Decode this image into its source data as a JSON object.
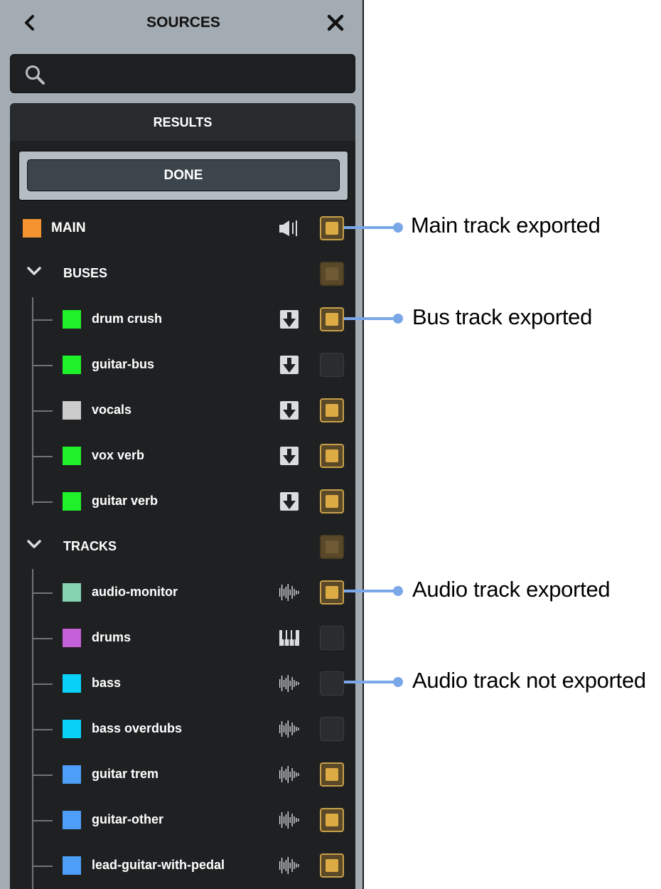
{
  "header": {
    "title": "SOURCES"
  },
  "search": {
    "placeholder": ""
  },
  "results": {
    "label": "RESULTS",
    "done_label": "DONE"
  },
  "main": {
    "label": "MAIN",
    "color": "#f59331",
    "icon": "speaker-icon",
    "exported": true
  },
  "buses": {
    "label": "BUSES",
    "items": [
      {
        "label": "drum crush",
        "color": "#1ef02a",
        "icon": "bus-down-arrow-icon",
        "exported": true
      },
      {
        "label": "guitar-bus",
        "color": "#1ef02a",
        "icon": "bus-down-arrow-icon",
        "exported": false
      },
      {
        "label": "vocals",
        "color": "#cccccc",
        "icon": "bus-down-arrow-icon",
        "exported": true
      },
      {
        "label": "vox verb",
        "color": "#1ef02a",
        "icon": "bus-down-arrow-icon",
        "exported": true
      },
      {
        "label": "guitar verb",
        "color": "#1ef02a",
        "icon": "bus-down-arrow-icon",
        "exported": true
      }
    ]
  },
  "tracks": {
    "label": "TRACKS",
    "items": [
      {
        "label": "audio-monitor",
        "color": "#86d3b2",
        "icon": "waveform-icon",
        "exported": true
      },
      {
        "label": "drums",
        "color": "#c460d8",
        "icon": "piano-keys-icon",
        "exported": false
      },
      {
        "label": "bass",
        "color": "#07d1f7",
        "icon": "waveform-icon",
        "exported": false
      },
      {
        "label": "bass overdubs",
        "color": "#07d1f7",
        "icon": "waveform-icon",
        "exported": false
      },
      {
        "label": "guitar trem",
        "color": "#4d9ef6",
        "icon": "waveform-icon",
        "exported": true
      },
      {
        "label": "guitar-other",
        "color": "#4d9ef6",
        "icon": "waveform-icon",
        "exported": true
      },
      {
        "label": "lead-guitar-with-pedal",
        "color": "#4d9ef6",
        "icon": "waveform-icon",
        "exported": true
      }
    ]
  },
  "callouts": [
    {
      "text": "Main track exported"
    },
    {
      "text": "Bus track exported"
    },
    {
      "text": "Audio track exported"
    },
    {
      "text": "Audio track not exported"
    }
  ],
  "colors": {
    "accent_checked": "#dcab44",
    "callout": "#7aa7e8"
  }
}
